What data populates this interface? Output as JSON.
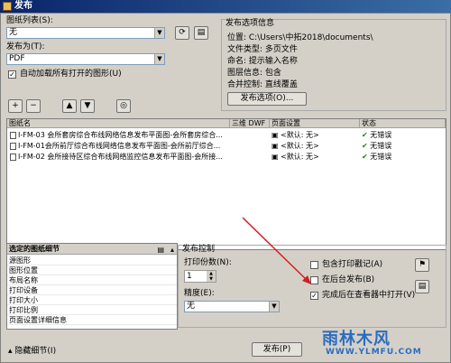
{
  "window": {
    "title": "发布"
  },
  "sheet_list": {
    "label": "图纸列表(S):",
    "value": "无"
  },
  "publish_to": {
    "label": "发布为(T):",
    "value": "PDF"
  },
  "auto_load": {
    "label": "自动加载所有打开的图形(U)",
    "checked": true,
    "check_glyph": "✓"
  },
  "publish_info": {
    "legend": "发布选项信息",
    "location": "位置: C:\\Users\\中拓2018\\documents\\",
    "file_type": "文件类型: 多页文件",
    "naming": "命名: 提示输入名称",
    "layer_info": "图层信息: 包含",
    "merge_control": "合并控制: 直线覆盖",
    "options_button": "发布选项(O)..."
  },
  "table": {
    "headers": [
      "图纸名",
      "三维 DWF",
      "页面设置",
      "状态"
    ],
    "rows": [
      {
        "name": "I-FM-03 会所套房综合布线网络信息发布平面图-会所套房综合...",
        "setup": "<默认: 无>",
        "status": "无错误"
      },
      {
        "name": "I-FM-01会所前厅综合布线网络信息发布平面图-会所前厅综合...",
        "setup": "<默认: 无>",
        "status": "无错误"
      },
      {
        "name": "I-FM-02 会所接待区综合布线网络监控信息发布平面图-会所接...",
        "setup": "<默认: 无>",
        "status": "无错误"
      }
    ]
  },
  "details": {
    "header": "选定的图纸细节",
    "rows": [
      "源图形",
      "图形位置",
      "布局名称",
      "打印设备",
      "打印大小",
      "打印比例",
      "页面设置详细信息"
    ]
  },
  "publish_control": {
    "legend": "发布控制",
    "copies_label": "打印份数(N):",
    "copies_value": "1",
    "precision_label": "精度(E):",
    "precision_value": "无",
    "include_stamp": "包含打印戳记(A)",
    "background_publish": "在后台发布(B)",
    "open_in_viewer": "完成后在查看器中打开(V)",
    "open_in_viewer_checked": true,
    "check_glyph": "✓"
  },
  "footer": {
    "hide_details": "隐藏细节(I)",
    "publish_button": "发布(P)"
  },
  "watermark": {
    "logo": "雨林木风",
    "url": "WWW.YLMFU.COM"
  },
  "colors": {
    "title_bar": "#0a246a",
    "dialog_bg": "#d4d0c8",
    "ok_green": "#1a8a1a",
    "arrow_red": "#d02020"
  }
}
